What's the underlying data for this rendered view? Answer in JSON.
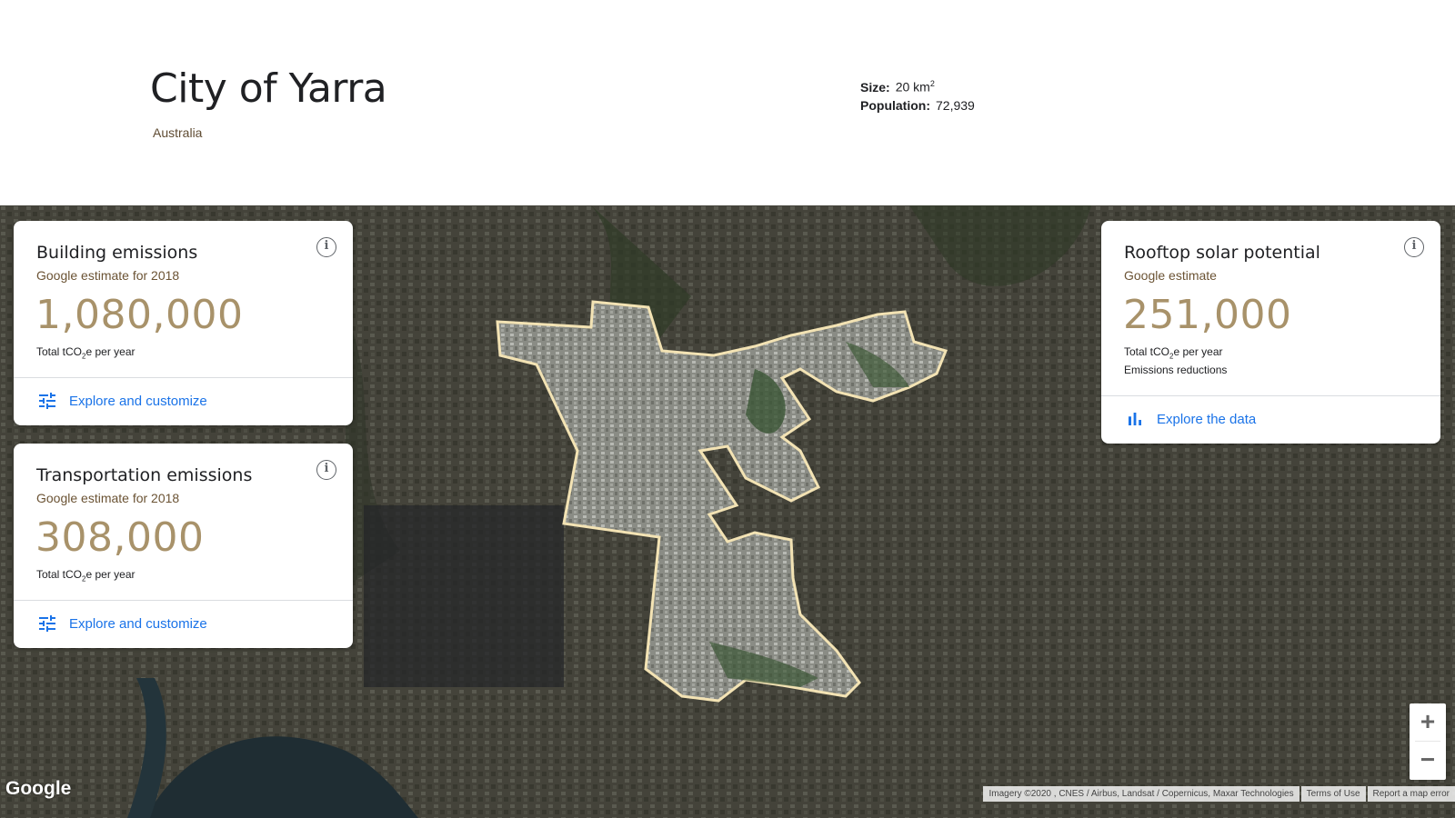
{
  "header": {
    "title": "City of Yarra",
    "country": "Australia",
    "size_label": "Size:",
    "size_value": "20 km",
    "size_sup": "2",
    "population_label": "Population:",
    "population_value": "72,939"
  },
  "cards": {
    "building": {
      "title": "Building emissions",
      "subtitle": "Google estimate for 2018",
      "value": "1,080,000",
      "unit_prefix": "Total tCO",
      "unit_sub": "2",
      "unit_suffix": "e per year",
      "action": "Explore and customize"
    },
    "transportation": {
      "title": "Transportation emissions",
      "subtitle": "Google estimate for 2018",
      "value": "308,000",
      "unit_prefix": "Total tCO",
      "unit_sub": "2",
      "unit_suffix": "e per year",
      "action": "Explore and customize"
    },
    "solar": {
      "title": "Rooftop solar potential",
      "subtitle": "Google estimate",
      "value": "251,000",
      "unit_prefix": "Total tCO",
      "unit_sub": "2",
      "unit_suffix": "e per year",
      "note": "Emissions reductions",
      "action": "Explore the data"
    }
  },
  "map": {
    "zoom_in": "+",
    "zoom_out": "−",
    "logo": "Google",
    "attribution": "Imagery ©2020 , CNES / Airbus, Landsat / Copernicus, Maxar Technologies",
    "terms": "Terms of Use",
    "report": "Report a map error",
    "boundary_color": "#f3e3b4"
  },
  "icons": {
    "info": "info-icon",
    "tune": "tune-icon",
    "bar_chart": "bar-chart-icon"
  },
  "colors": {
    "value": "#a8926a",
    "link": "#1a73e8",
    "subtitle": "#6b5334"
  }
}
